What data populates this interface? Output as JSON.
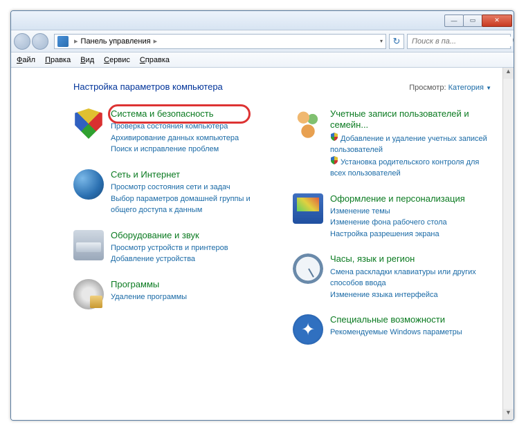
{
  "window": {
    "breadcrumb_root": "Панель управления",
    "search_placeholder": "Поиск в па..."
  },
  "menubar": [
    "Файл",
    "Правка",
    "Вид",
    "Сервис",
    "Справка"
  ],
  "heading": "Настройка параметров компьютера",
  "viewby": {
    "label": "Просмотр:",
    "value": "Категория"
  },
  "left_categories": [
    {
      "key": "system-security",
      "icon": "ic-security",
      "title": "Система и безопасность",
      "highlighted": true,
      "links": [
        {
          "text": "Проверка состояния компьютера"
        },
        {
          "text": "Архивирование данных компьютера"
        },
        {
          "text": "Поиск и исправление проблем"
        }
      ]
    },
    {
      "key": "network-internet",
      "icon": "ic-network",
      "title": "Сеть и Интернет",
      "links": [
        {
          "text": "Просмотр состояния сети и задач"
        },
        {
          "text": "Выбор параметров домашней группы и общего доступа к данным"
        }
      ]
    },
    {
      "key": "hardware-sound",
      "icon": "ic-hardware",
      "title": "Оборудование и звук",
      "links": [
        {
          "text": "Просмотр устройств и принтеров"
        },
        {
          "text": "Добавление устройства"
        }
      ]
    },
    {
      "key": "programs",
      "icon": "ic-programs",
      "title": "Программы",
      "links": [
        {
          "text": "Удаление программы"
        }
      ]
    }
  ],
  "right_categories": [
    {
      "key": "user-accounts",
      "icon": "ic-users",
      "title": "Учетные записи пользователей и семейн...",
      "links": [
        {
          "text": "Добавление и удаление учетных записей пользователей",
          "shield": true
        },
        {
          "text": "Установка родительского контроля для всех пользователей",
          "shield": true
        }
      ]
    },
    {
      "key": "appearance",
      "icon": "ic-appearance",
      "title": "Оформление и персонализация",
      "links": [
        {
          "text": "Изменение темы"
        },
        {
          "text": "Изменение фона рабочего стола"
        },
        {
          "text": "Настройка разрешения экрана"
        }
      ]
    },
    {
      "key": "clock-region",
      "icon": "ic-clock",
      "title": "Часы, язык и регион",
      "links": [
        {
          "text": "Смена раскладки клавиатуры или других способов ввода"
        },
        {
          "text": "Изменение языка интерфейса"
        }
      ]
    },
    {
      "key": "ease-access",
      "icon": "ic-access",
      "title": "Специальные возможности",
      "links": [
        {
          "text": "Рекомендуемые Windows параметры"
        }
      ]
    }
  ]
}
